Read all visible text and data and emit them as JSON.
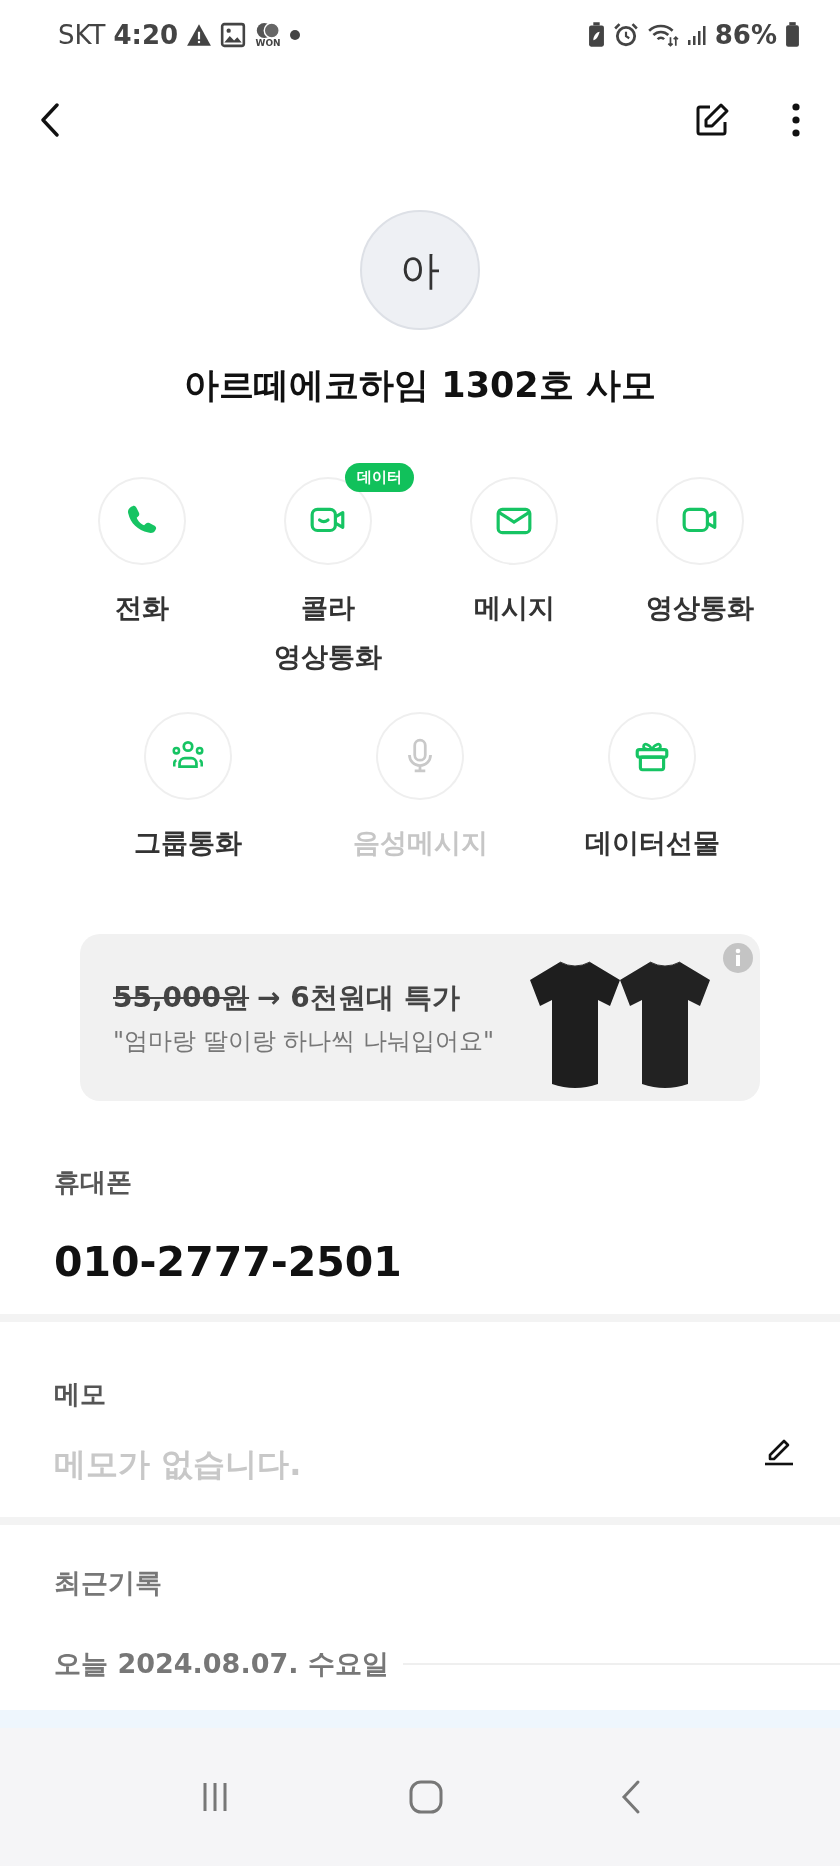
{
  "status_bar": {
    "carrier": "SKT",
    "time": "4:20",
    "notification_label": "WON",
    "battery": "86%"
  },
  "contact": {
    "avatar": "아",
    "name": "아르떼에코하임 1302호 사모"
  },
  "actions": [
    {
      "label": "전화",
      "kind": "phone",
      "disabled": false
    },
    {
      "label": "콜라\n영상통화",
      "kind": "smile-video",
      "disabled": false,
      "badge": "데이터"
    },
    {
      "label": "메시지",
      "kind": "mail",
      "disabled": false
    },
    {
      "label": "영상통화",
      "kind": "video",
      "disabled": false
    }
  ],
  "actions_row_2": [
    {
      "label": "그룹통화",
      "kind": "group",
      "disabled": false
    },
    {
      "label": "음성메시지",
      "kind": "mic",
      "disabled": true
    },
    {
      "label": "데이터선물",
      "kind": "gift",
      "disabled": false
    }
  ],
  "ad_banner": {
    "original_price": "55,000원",
    "offer": "→ 6천원대 특가",
    "quote": "\"엄마랑 딸이랑 하나씩 나눠입어요\""
  },
  "phone": {
    "label": "휴대폰",
    "number": "010-2777-2501"
  },
  "memo": {
    "label": "메모",
    "empty_text": "메모가 없습니다."
  },
  "recent": {
    "title": "최근기록",
    "date_header": "오늘 2024.08.07. 수요일"
  }
}
